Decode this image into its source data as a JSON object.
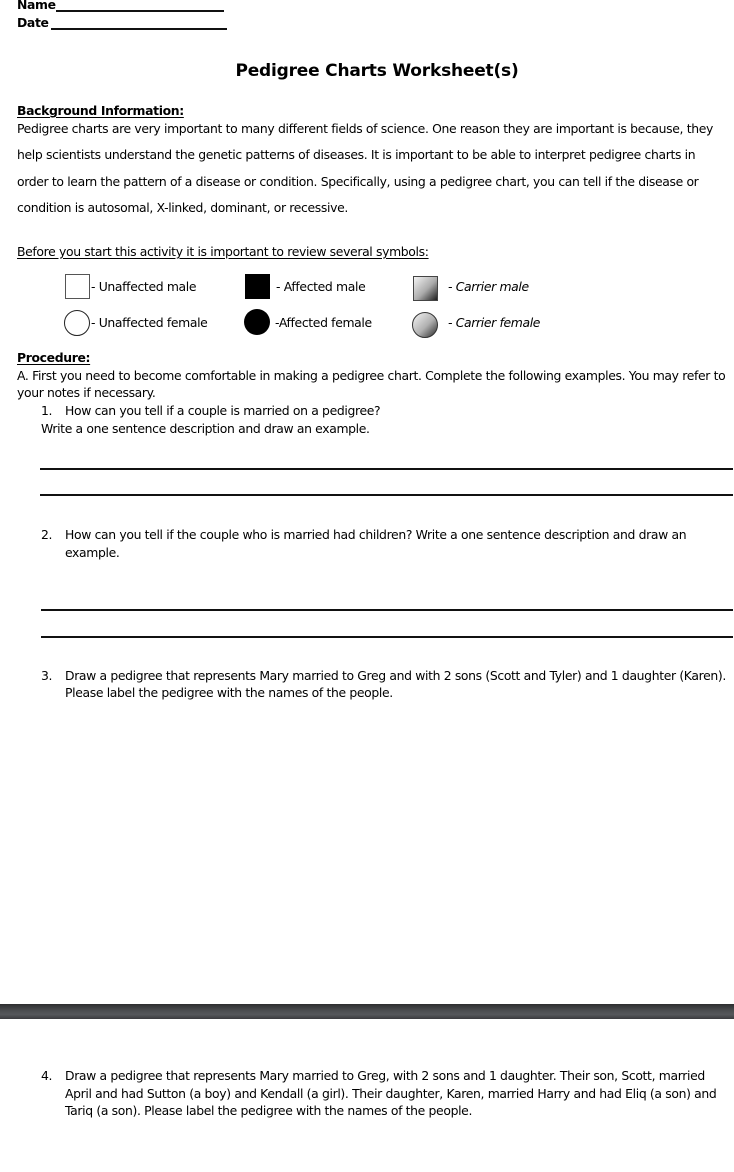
{
  "header": {
    "name_label": "Name",
    "date_label": "Date"
  },
  "title": "Pedigree Charts Worksheet(s)",
  "background": {
    "heading": "Background Information:",
    "lines": [
      "Pedigree charts are very important to many different fields of science. One reason they are important is because, they",
      "help scientists understand the genetic patterns of diseases.  It is important to be able to interpret pedigree charts in",
      "order to learn the pattern of a disease or condition.  Specifically, using a pedigree chart, you can tell if the disease or",
      "condition is autosomal, X-linked, dominant, or recessive."
    ]
  },
  "symbols": {
    "heading": "Before you start this activity it is important to review several symbols:",
    "items": [
      {
        "icon": "unaffected-male-square",
        "label": "- Unaffected male"
      },
      {
        "icon": "affected-male-square",
        "label": "- Affected male"
      },
      {
        "icon": "carrier-male-square",
        "label": "- Carrier male"
      },
      {
        "icon": "unaffected-female-circle",
        "label": "- Unaffected female"
      },
      {
        "icon": "affected-female-circle",
        "label": "-Affected female"
      },
      {
        "icon": "carrier-female-circle",
        "label": "- Carrier female"
      }
    ]
  },
  "procedure": {
    "heading": "Procedure:",
    "intro_lines": [
      "A.  First you need to become comfortable in making a pedigree chart. Complete the following examples.  You may refer to",
      "your notes if necessary."
    ],
    "questions": [
      {
        "number": "1.",
        "lines": [
          "How can you tell if a couple is married on a pedigree?"
        ],
        "extra": "Write a one sentence description and draw an example."
      },
      {
        "number": "2.",
        "lines": [
          "How can you tell if the couple who is married had children?  Write a one sentence description and draw an",
          "example."
        ]
      },
      {
        "number": "3.",
        "lines": [
          "Draw a pedigree that represents Mary married to Greg and with 2 sons (Scott and Tyler) and 1 daughter (Karen).",
          "Please label the pedigree with the names of the people."
        ]
      },
      {
        "number": "4.",
        "lines": [
          "Draw a pedigree that represents Mary married to Greg, with 2 sons and 1 daughter.  Their son, Scott, married",
          "April and had Sutton (a boy) and Kendall (a girl).  Their daughter, Karen, married Harry and had Eliq (a son) and",
          "Tariq (a son).  Please label the pedigree with the names of the people."
        ]
      }
    ]
  }
}
